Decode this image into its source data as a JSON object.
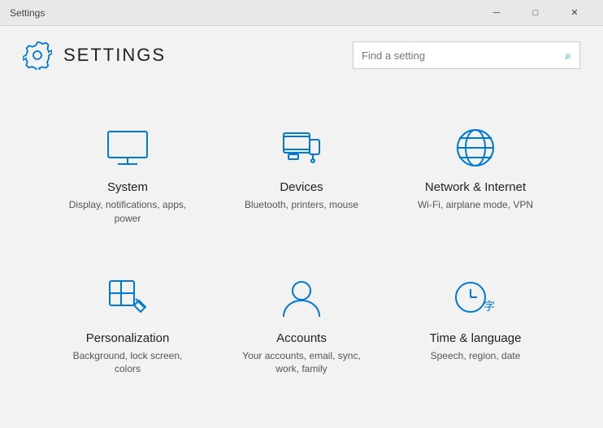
{
  "titlebar": {
    "title": "Settings",
    "minimize": "─",
    "maximize": "□",
    "close": "✕"
  },
  "header": {
    "title": "SETTINGS",
    "search_placeholder": "Find a setting"
  },
  "items": [
    {
      "id": "system",
      "title": "System",
      "desc": "Display, notifications, apps, power",
      "icon": "system"
    },
    {
      "id": "devices",
      "title": "Devices",
      "desc": "Bluetooth, printers, mouse",
      "icon": "devices"
    },
    {
      "id": "network",
      "title": "Network & Internet",
      "desc": "Wi-Fi, airplane mode, VPN",
      "icon": "network"
    },
    {
      "id": "personalization",
      "title": "Personalization",
      "desc": "Background, lock screen, colors",
      "icon": "personalization"
    },
    {
      "id": "accounts",
      "title": "Accounts",
      "desc": "Your accounts, email, sync, work, family",
      "icon": "accounts"
    },
    {
      "id": "time",
      "title": "Time & language",
      "desc": "Speech, region, date",
      "icon": "time"
    }
  ]
}
